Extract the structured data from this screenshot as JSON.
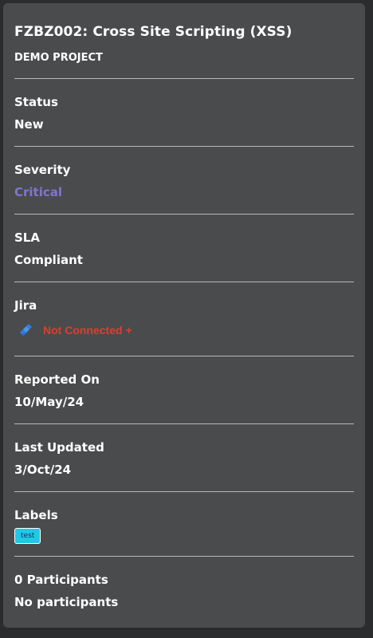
{
  "issue": {
    "title": "FZBZ002: Cross Site Scripting (XSS)",
    "project": "DEMO PROJECT"
  },
  "fields": {
    "status": {
      "label": "Status",
      "value": "New"
    },
    "severity": {
      "label": "Severity",
      "value": "Critical",
      "color": "#7f75d1"
    },
    "sla": {
      "label": "SLA",
      "value": "Compliant"
    },
    "jira": {
      "label": "Jira",
      "status": "Not Connected +",
      "status_color": "#d9402f",
      "icon": "jira-icon"
    },
    "reported_on": {
      "label": "Reported On",
      "value": "10/May/24"
    },
    "last_updated": {
      "label": "Last Updated",
      "value": "3/Oct/24"
    },
    "labels": {
      "label": "Labels",
      "tags": [
        "test"
      ],
      "tag_color": "#21c7e6"
    },
    "participants": {
      "label": "0 Participants",
      "value": "No participants"
    }
  },
  "colors": {
    "panel_bg": "#4a4b4d",
    "page_bg": "#2b2c2e"
  }
}
